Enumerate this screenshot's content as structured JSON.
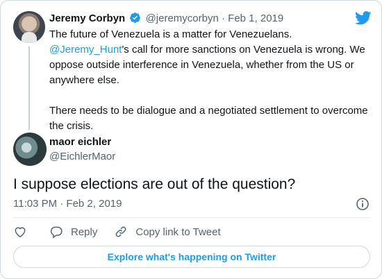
{
  "parent_tweet": {
    "name": "Jeremy Corbyn",
    "handle": "@jeremycorbyn",
    "separator": "·",
    "date": "Feb 1, 2019",
    "line1": "The future of Venezuela is a matter for Venezuelans.",
    "mention": "@Jeremy_Hunt",
    "line2_rest": "'s call for more sanctions on Venezuela is wrong. We oppose outside interference in Venezuela, whether from the US or anywhere else.",
    "para2": "There needs to be dialogue and a negotiated settlement to overcome the crisis."
  },
  "main_tweet": {
    "name": "maor eichler",
    "handle": "@EichlerMaor",
    "text": "I suppose elections are out of the question?",
    "timestamp": "11:03 PM · Feb 2, 2019"
  },
  "actions": {
    "reply_label": "Reply",
    "copy_label": "Copy link to Tweet"
  },
  "explore_label": "Explore what's happening on Twitter",
  "colors": {
    "accent": "#1d9bf0",
    "text": "#0f1419",
    "muted": "#536471",
    "border": "#cfd9de"
  },
  "icons": [
    "verified-badge-icon",
    "twitter-bird-icon",
    "info-icon",
    "heart-icon",
    "reply-icon",
    "link-icon"
  ]
}
